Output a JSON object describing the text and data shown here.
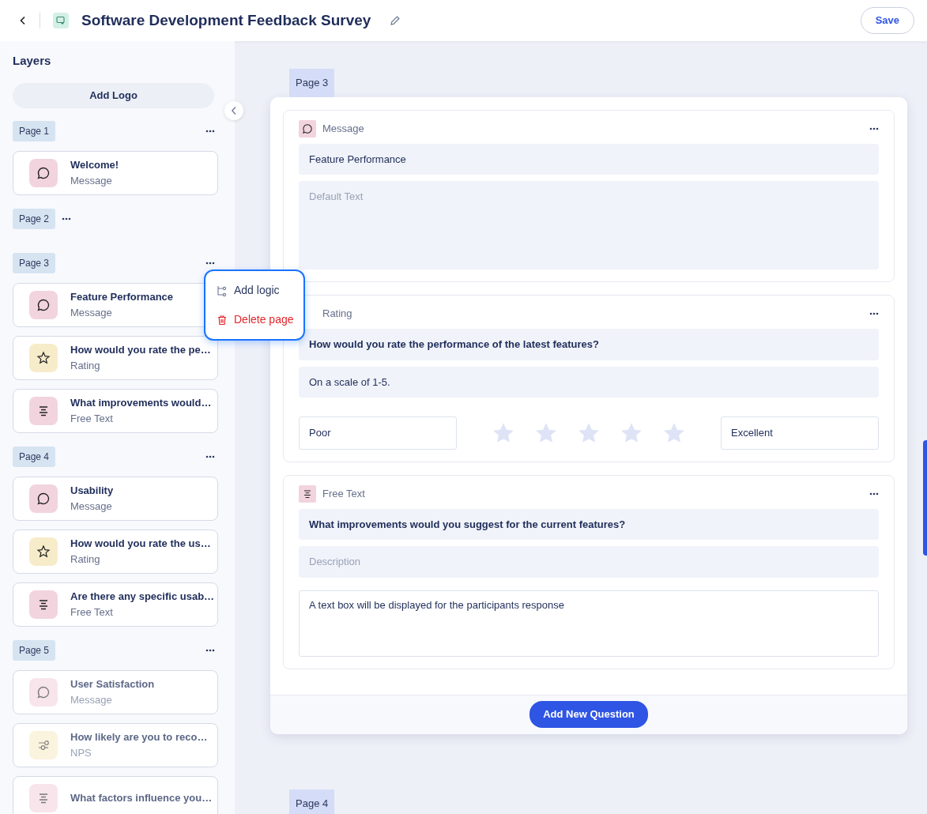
{
  "header": {
    "title": "Software Development Feedback Survey",
    "save_button": "Save"
  },
  "sidebar": {
    "title": "Layers",
    "add_logo": "Add Logo",
    "pages": [
      {
        "label": "Page 1",
        "items": [
          {
            "title": "Welcome!",
            "type_label": "Message",
            "kind": "message",
            "dimmed": false
          }
        ]
      },
      {
        "label": "Page 2"
      },
      {
        "label": "Page 3",
        "items": [
          {
            "title": "Feature Performance",
            "type_label": "Message",
            "kind": "message",
            "dimmed": false
          },
          {
            "title": "How would you rate the pe…",
            "type_label": "Rating",
            "kind": "rating",
            "dimmed": false
          },
          {
            "title": "What improvements would…",
            "type_label": "Free Text",
            "kind": "free_text",
            "dimmed": false
          }
        ]
      },
      {
        "label": "Page 4",
        "items": [
          {
            "title": "Usability",
            "type_label": "Message",
            "kind": "message",
            "dimmed": false
          },
          {
            "title": "How would you rate the us…",
            "type_label": "Rating",
            "kind": "rating",
            "dimmed": false
          },
          {
            "title": "Are there any specific usab…",
            "type_label": "Free Text",
            "kind": "free_text",
            "dimmed": false
          }
        ]
      },
      {
        "label": "Page 5",
        "items": [
          {
            "title": "User Satisfaction",
            "type_label": "Message",
            "kind": "message",
            "dimmed": true
          },
          {
            "title": "How likely are you to reco…",
            "type_label": "NPS",
            "kind": "nps",
            "dimmed": true
          },
          {
            "title": "What factors influence you…",
            "kind": "free_text",
            "dimmed": true
          }
        ]
      }
    ]
  },
  "context_menu": {
    "items": [
      {
        "label": "Add logic",
        "kind": "logic"
      },
      {
        "label": "Delete page",
        "kind": "delete"
      }
    ]
  },
  "canvas": {
    "page_label": "Page 3",
    "questions": [
      {
        "kind": "message",
        "type_label": "Message",
        "title": "Feature Performance",
        "placeholder": "Default Text"
      },
      {
        "kind": "rating",
        "type_label": "Rating",
        "title": "How would you rate the performance of the latest features?",
        "description": "On a scale of 1-5.",
        "low_label": "Poor",
        "high_label": "Excellent",
        "stars": 0
      },
      {
        "kind": "free_text",
        "type_label": "Free Text",
        "title": "What improvements would you suggest for the current features?",
        "placeholder": "Description",
        "response_hint": "A text box will be displayed for the participants response"
      }
    ],
    "add_button": "Add New Question",
    "next_page_label": "Page 4"
  }
}
